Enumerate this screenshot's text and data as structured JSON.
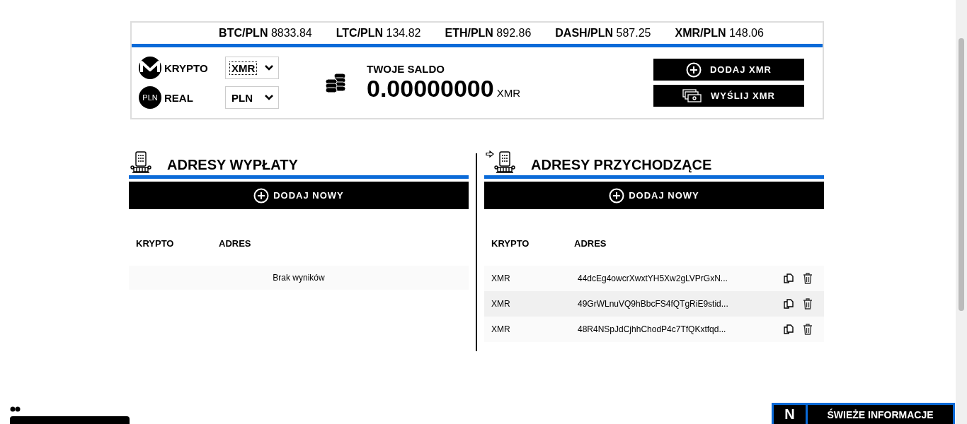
{
  "ticker": [
    {
      "pair": "BTC/PLN",
      "price": "8833.84"
    },
    {
      "pair": "LTC/PLN",
      "price": "134.82"
    },
    {
      "pair": "ETH/PLN",
      "price": "892.86"
    },
    {
      "pair": "DASH/PLN",
      "price": "587.25"
    },
    {
      "pair": "XMR/PLN",
      "price": "148.06"
    }
  ],
  "currency_selectors": [
    {
      "kind": "monero",
      "label": "KRYPTO",
      "value": "XMR",
      "focused": true
    },
    {
      "kind": "badge",
      "badge": "PLN",
      "label": "REAL",
      "value": "PLN",
      "focused": false
    }
  ],
  "balance": {
    "label": "TWOJE SALDO",
    "amount": "0.00000000",
    "unit": "XMR"
  },
  "actions": [
    {
      "kind": "add",
      "label": "DODAJ XMR"
    },
    {
      "kind": "send",
      "label": "WYŚLIJ XMR"
    }
  ],
  "sections": [
    {
      "kind": "outgoing",
      "title": "ADRESY WYPŁATY",
      "add_button": "DODAJ NOWY",
      "columns": [
        "KRYPTO",
        "ADRES"
      ],
      "empty_text": "Brak wyników"
    },
    {
      "kind": "incoming",
      "title": "ADRESY PRZYCHODZĄCE",
      "add_button": "DODAJ NOWY",
      "columns": [
        "KRYPTO",
        "ADRES"
      ],
      "rows": [
        {
          "crypto": "XMR",
          "address": "44dcEg4owcrXwxtYH5Xw2gLVPrGxN..."
        },
        {
          "crypto": "XMR",
          "address": "49GrWLnuVQ9hBbcFS4fQTgRiE9stid..."
        },
        {
          "crypto": "XMR",
          "address": "48R4NSpJdCjhhChodP4c7TfQKxtfqd..."
        }
      ]
    }
  ],
  "news_tab": {
    "badge": "N",
    "label": "ŚWIEŻE INFORMACJE"
  }
}
